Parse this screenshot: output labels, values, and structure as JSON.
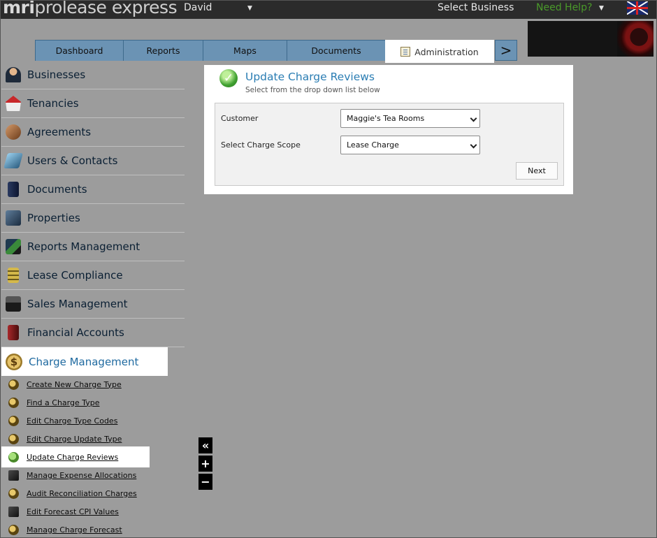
{
  "header": {
    "logo_mri": "mri",
    "logo_rest": "prolease express",
    "user_name": "David",
    "select_business": "Select Business",
    "need_help": "Need Help?"
  },
  "tabs": [
    {
      "label": "Dashboard"
    },
    {
      "label": "Reports"
    },
    {
      "label": "Maps"
    },
    {
      "label": "Documents"
    },
    {
      "label": "Administration",
      "active": true
    }
  ],
  "tab_next_label": ">",
  "sidebar": {
    "items": [
      {
        "label": "Businesses",
        "icon": "businessman-icon"
      },
      {
        "label": "Tenancies",
        "icon": "house-icon"
      },
      {
        "label": "Agreements",
        "icon": "handshake-icon"
      },
      {
        "label": "Users & Contacts",
        "icon": "contact-card-icon"
      },
      {
        "label": "Documents",
        "icon": "binder-icon"
      },
      {
        "label": "Properties",
        "icon": "building-icon"
      },
      {
        "label": "Reports Management",
        "icon": "report-chart-icon"
      },
      {
        "label": "Lease Compliance",
        "icon": "checklist-icon"
      },
      {
        "label": "Sales Management",
        "icon": "cash-register-icon"
      },
      {
        "label": "Financial Accounts",
        "icon": "ledger-icon"
      },
      {
        "label": "Charge Management",
        "icon": "dollar-coin-icon",
        "active": true
      }
    ],
    "charge_icon_glyph": "$",
    "subitems": [
      {
        "label": "Create New Charge Type"
      },
      {
        "label": "Find a Charge Type"
      },
      {
        "label": "Edit Charge Type Codes"
      },
      {
        "label": "Edit Charge Update Type"
      },
      {
        "label": "Update Charge Reviews",
        "active": true
      },
      {
        "label": "Manage Expense Allocations"
      },
      {
        "label": "Audit Reconciliation Charges"
      },
      {
        "label": "Edit Forecast CPI Values"
      },
      {
        "label": "Manage Charge Forecast"
      }
    ]
  },
  "controls": {
    "collapse": "«",
    "zoom_in": "+",
    "zoom_out": "−"
  },
  "panel": {
    "title": "Update Charge Reviews",
    "subtitle": "Select from the drop down list below",
    "check_glyph": "✓",
    "fields": {
      "customer_label": "Customer",
      "customer_value": "Maggie's Tea Rooms",
      "scope_label": "Select Charge Scope",
      "scope_value": "Lease Charge"
    },
    "next_label": "Next"
  },
  "colors": {
    "tab_blue": "#6b93b4",
    "title_blue": "#2a7db3",
    "help_green": "#4a9a2a",
    "background_gray": "#9c9c9c"
  }
}
